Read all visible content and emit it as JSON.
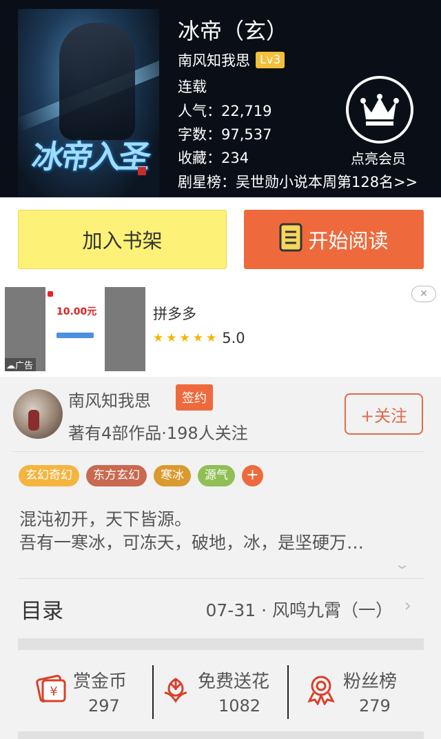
{
  "book": {
    "title": "冰帝（玄）",
    "author": "南风知我思",
    "author_level": "Lv3",
    "status": "连载",
    "popularity": "人气：22,719",
    "word_count": "字数：97,537",
    "favorites": "收藏：234",
    "ranking": "剧星榜：吴世勋小说本周第128名>>",
    "cover_title_art": "冰帝入圣"
  },
  "vip": {
    "label": "点亮会员",
    "icon": "crown-icon"
  },
  "actions": {
    "add_shelf": "加入书架",
    "start_read": "开始阅读"
  },
  "ad": {
    "app_name": "拼多多",
    "rating": "5.0",
    "stars": "★★★★★",
    "tag": "广告",
    "close": "✕",
    "image_amount": "10.00元"
  },
  "author_card": {
    "name": "南风知我思",
    "signed_badge": "签约",
    "works_info": "著有4部作品·198人关注",
    "follow_label": "+关注"
  },
  "tags": [
    {
      "label": "玄幻奇幻",
      "color": "#f4b53f"
    },
    {
      "label": "东方玄幻",
      "color": "#c9694f"
    },
    {
      "label": "寒冰",
      "color": "#d99a2e"
    },
    {
      "label": "源气",
      "color": "#8fbf55"
    }
  ],
  "tag_add": "+",
  "description": {
    "line1": "混沌初开，天下皆源。",
    "line2": "吾有一寒冰，可冻天，破地，冰，是坚硬万…"
  },
  "toc": {
    "label": "目录",
    "latest": "07-31 · 风鸣九霄（一）"
  },
  "stats": {
    "reward": {
      "label": "赏金币",
      "value": "297"
    },
    "flowers": {
      "label": "免费送花",
      "value": "1082"
    },
    "fans": {
      "label": "粉丝榜",
      "value": "279"
    }
  },
  "colors": {
    "accent_orange": "#ee6a3c",
    "shelf_yellow": "#fdf277",
    "icon_red": "#d8402a"
  }
}
